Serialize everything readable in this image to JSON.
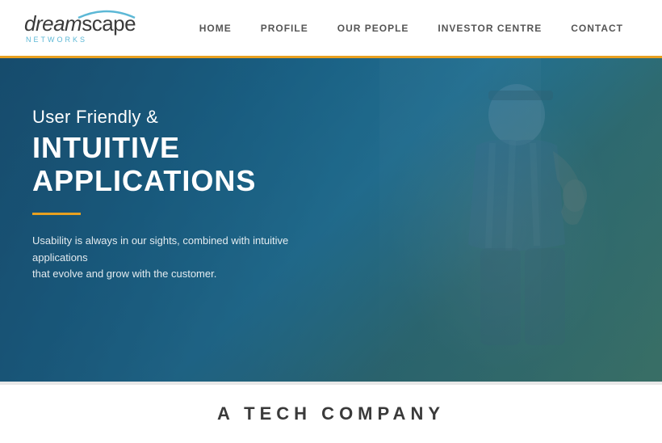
{
  "header": {
    "logo": {
      "name": "dreamscape",
      "sub": "NETWORKS"
    },
    "nav": [
      {
        "label": "HOME",
        "active": false
      },
      {
        "label": "PROFILE",
        "active": false
      },
      {
        "label": "OUR PEOPLE",
        "active": false
      },
      {
        "label": "INVESTOR CENTRE",
        "active": false
      },
      {
        "label": "CONTACT",
        "active": false
      }
    ]
  },
  "hero": {
    "subtitle": "User Friendly &",
    "title": "INTUITIVE APPLICATIONS",
    "description_line1": "Usability is always in our sights, combined with intuitive applications",
    "description_line2": "that evolve and grow with the customer."
  },
  "bottom": {
    "title": "A TECH COMPANY"
  },
  "colors": {
    "accent": "#e8a020",
    "blue": "#5cb8d6",
    "hero_bg": "#1e7a9e"
  }
}
